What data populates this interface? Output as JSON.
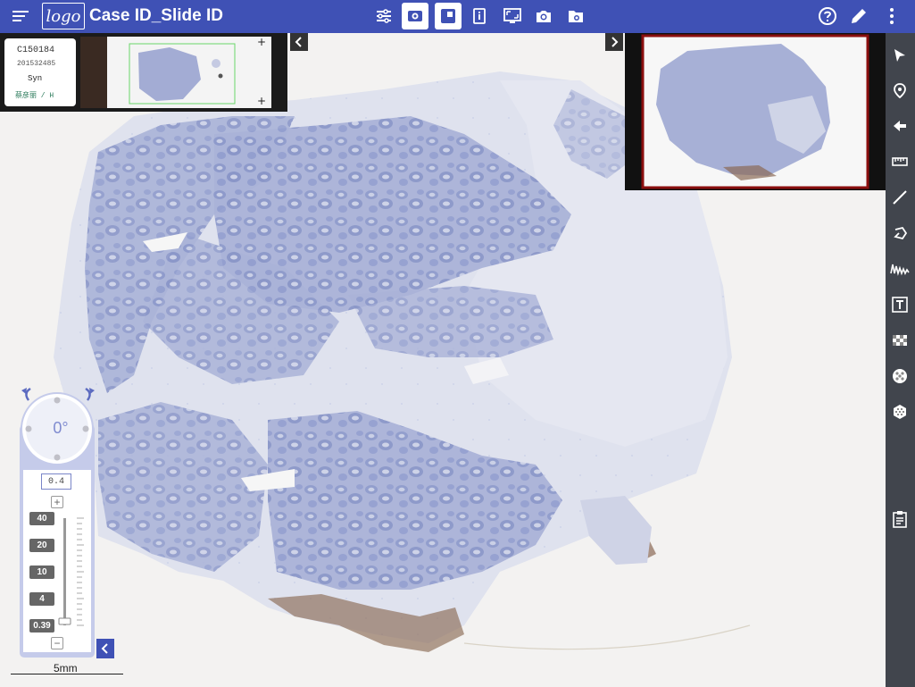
{
  "app": {
    "title": "Case ID_Slide ID",
    "logo_text": "logo"
  },
  "toolbar": {
    "center_tools": [
      {
        "name": "adjust-settings",
        "active": false
      },
      {
        "name": "image-tool",
        "active": true
      },
      {
        "name": "overview-window",
        "active": true
      },
      {
        "name": "slide-info",
        "active": false
      },
      {
        "name": "fullscreen",
        "active": false
      },
      {
        "name": "camera",
        "active": false
      },
      {
        "name": "saved-snapshots",
        "active": false
      }
    ],
    "right_tools": [
      "help-icon",
      "edit-icon",
      "more-vert-icon"
    ]
  },
  "slide_label": {
    "line1": "C150184",
    "line2": "201532485",
    "line3": "Syn",
    "line4": "蔡彦丽 / H"
  },
  "sidebar": {
    "tools": [
      "pointer",
      "location-pin",
      "arrow",
      "ruler",
      "line",
      "polygon",
      "freehand",
      "text",
      "checker-pattern",
      "dots-pattern",
      "hex-pattern",
      "report"
    ]
  },
  "zoom": {
    "rotation": "0°",
    "current": "0.4",
    "presets": [
      "40",
      "20",
      "10",
      "4",
      "0.39"
    ],
    "plus": "+",
    "minus": "−"
  },
  "scalebar": {
    "label": "5mm"
  },
  "colors": {
    "topbar": "#3f51b5",
    "sidebar": "#41454d",
    "tissue": "#b9c1de",
    "tissue_dark": "#8f9bc9",
    "stain_brown": "#8a6a55",
    "minimap_frame": "#8b0f0f",
    "viewport_frame": "#6ad66a"
  }
}
